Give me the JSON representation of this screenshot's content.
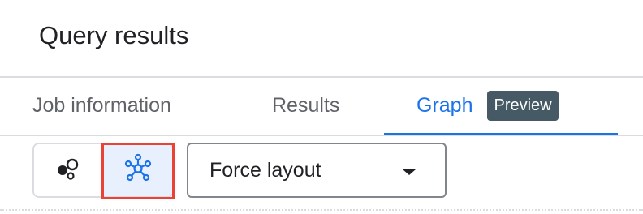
{
  "header": {
    "title": "Query results"
  },
  "tabs": [
    {
      "label": "Job information",
      "selected": false
    },
    {
      "label": "Results",
      "selected": false
    },
    {
      "label": "Graph",
      "selected": true,
      "badge": "Preview"
    }
  ],
  "toolbar": {
    "view_toggle": [
      {
        "icon": "bubbles-icon",
        "selected": false
      },
      {
        "icon": "network-graph-icon",
        "selected": true
      }
    ],
    "layout_select": {
      "value": "Force layout"
    }
  },
  "colors": {
    "accent": "#1a73e8",
    "badge_bg": "#455a64",
    "active_toggle_bg": "#e8f0fe",
    "highlight_outline": "#ea4335",
    "text_muted": "#5f6368",
    "text_primary": "#202124"
  }
}
